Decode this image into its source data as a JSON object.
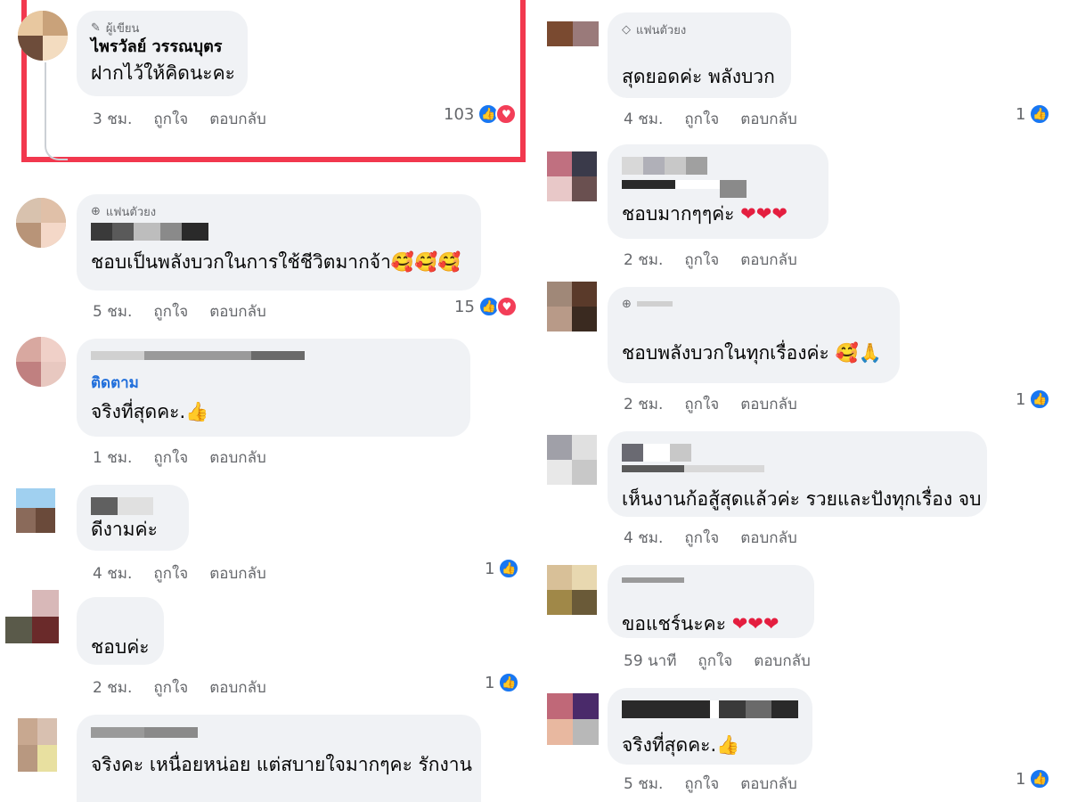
{
  "c1": {
    "badge": "ผู้เขียน",
    "author": "ไพรวัลย์ วรรณบุตร",
    "text": "ฝากไว้ให้คิดนะคะ",
    "time": "3 ชม.",
    "like": "ถูกใจ",
    "reply": "ตอบกลับ",
    "count": "103"
  },
  "c2": {
    "badge": "แฟนตัวยง",
    "text": "ชอบเป็นพลังบวกในการใช้ชีวิตมากจ้า🥰🥰🥰",
    "time": "5 ชม.",
    "like": "ถูกใจ",
    "reply": "ตอบกลับ",
    "count": "15"
  },
  "c3": {
    "follow": "ติดตาม",
    "text": "จริงที่สุดคะ.👍",
    "time": "1 ชม.",
    "like": "ถูกใจ",
    "reply": "ตอบกลับ"
  },
  "c4": {
    "text": "ดีงามค่ะ",
    "time": "4 ชม.",
    "like": "ถูกใจ",
    "reply": "ตอบกลับ",
    "count": "1"
  },
  "c5": {
    "text": "ชอบค่ะ",
    "time": "2 ชม.",
    "like": "ถูกใจ",
    "reply": "ตอบกลับ",
    "count": "1"
  },
  "c6": {
    "text": "จริงคะ เหนื่อยหน่อย แต่สบายใจมากๆคะ รักงาน"
  },
  "r1": {
    "badge": "แฟนตัวยง",
    "text": "สุดยอดค่ะ พลังบวก",
    "time": "4 ชม.",
    "like": "ถูกใจ",
    "reply": "ตอบกลับ",
    "count": "1"
  },
  "r2": {
    "text": "ชอบมากๆๆค่ะ",
    "time": "2 ชม.",
    "like": "ถูกใจ",
    "reply": "ตอบกลับ"
  },
  "r3": {
    "text": "ชอบพลังบวกในทุกเรื่องค่ะ 🥰🙏",
    "time": "2 ชม.",
    "like": "ถูกใจ",
    "reply": "ตอบกลับ",
    "count": "1"
  },
  "r4": {
    "text": "เห็นงานก้อสู้สุดแล้วค่ะ รวยและปังทุกเรื่อง จบ",
    "time": "4 ชม.",
    "like": "ถูกใจ",
    "reply": "ตอบกลับ"
  },
  "r5": {
    "text": "ขอแชร์นะคะ",
    "time": "59 นาที",
    "like": "ถูกใจ",
    "reply": "ตอบกลับ"
  },
  "r6": {
    "text": "จริงที่สุดคะ.👍",
    "time": "5 ชม.",
    "like": "ถูกใจ",
    "reply": "ตอบกลับ",
    "count": "1"
  }
}
